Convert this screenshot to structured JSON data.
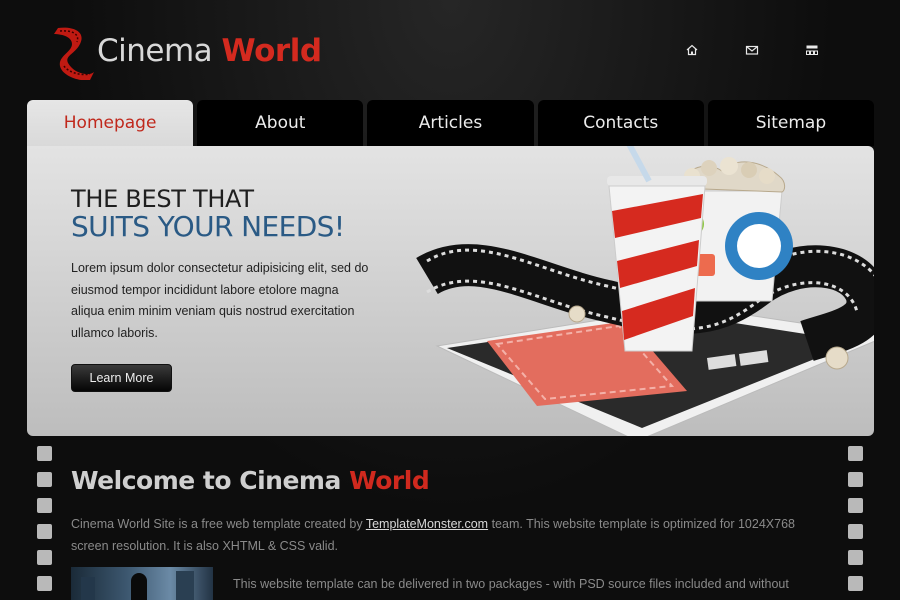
{
  "header": {
    "logo": {
      "word1": "Cinema",
      "word2": "World"
    },
    "icons": [
      {
        "name": "home-icon"
      },
      {
        "name": "mail-icon"
      },
      {
        "name": "sitemap-icon"
      }
    ]
  },
  "nav": {
    "tabs": [
      {
        "label": "Homepage",
        "active": true
      },
      {
        "label": "About"
      },
      {
        "label": "Articles"
      },
      {
        "label": "Contacts"
      },
      {
        "label": "Sitemap"
      }
    ]
  },
  "hero": {
    "heading_line1": "THE BEST THAT",
    "heading_line2": "SUITS YOUR NEEDS!",
    "text": "Lorem ipsum dolor consectetur adipisicing elit, sed do eiusmod tempor incididunt labore etolore magna aliqua enim minim veniam quis nostrud exercitation ullamco laboris.",
    "button_label": "Learn More"
  },
  "content": {
    "welcome_part1": "Welcome to Cinema",
    "welcome_part2": "World",
    "intro_before": "Cinema World Site is a free web template created by ",
    "intro_link": "TemplateMonster.com",
    "intro_after": " team. This website template is optimized for 1024X768 screen resolution. It is also XHTML & CSS valid.",
    "para2": "This website template can be delivered in two packages - with PSD source files included and without"
  },
  "colors": {
    "accent_red": "#d0291e",
    "hero_blue": "#2a5a85",
    "background": "#0e0e0e"
  }
}
